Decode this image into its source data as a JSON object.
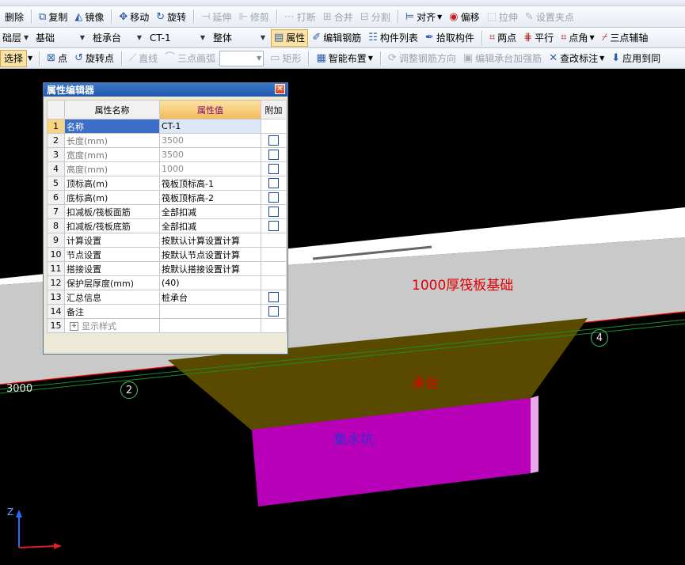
{
  "toolbar1": {
    "items": [
      {
        "label": "删除",
        "icon": "delete-icon"
      },
      {
        "label": "复制",
        "icon": "copy-icon"
      },
      {
        "label": "镜像",
        "icon": "mirror-icon"
      },
      {
        "label": "移动",
        "icon": "move-icon"
      },
      {
        "label": "旋转",
        "icon": "rotate-icon"
      },
      {
        "label": "延伸",
        "icon": "extend-icon",
        "disabled": true
      },
      {
        "label": "修剪",
        "icon": "trim-icon",
        "disabled": true
      },
      {
        "label": "打断",
        "icon": "break-icon",
        "disabled": true
      },
      {
        "label": "合并",
        "icon": "merge-icon",
        "disabled": true
      },
      {
        "label": "分割",
        "icon": "split-icon",
        "disabled": true
      },
      {
        "label": "对齐",
        "icon": "align-icon"
      },
      {
        "label": "偏移",
        "icon": "offset-icon"
      },
      {
        "label": "拉伸",
        "icon": "stretch-icon",
        "disabled": true
      },
      {
        "label": "设置夹点",
        "icon": "grip-icon",
        "disabled": true
      }
    ]
  },
  "toolbar2": {
    "floor": "础层",
    "category": "基础",
    "type": "桩承台",
    "element": "CT-1",
    "scope": "整体",
    "items": [
      {
        "label": "属性",
        "icon": "property-icon",
        "active": true
      },
      {
        "label": "编辑钢筋",
        "icon": "edit-rebar-icon"
      },
      {
        "label": "构件列表",
        "icon": "component-list-icon"
      },
      {
        "label": "拾取构件",
        "icon": "pick-icon"
      },
      {
        "label": "两点",
        "icon": "two-point-icon"
      },
      {
        "label": "平行",
        "icon": "parallel-icon"
      },
      {
        "label": "点角",
        "icon": "point-angle-icon"
      },
      {
        "label": "三点辅轴",
        "icon": "three-point-axis-icon"
      }
    ]
  },
  "toolbar3": {
    "select_label": "选择",
    "items": [
      {
        "label": "点",
        "icon": "point-icon"
      },
      {
        "label": "旋转点",
        "icon": "rotate-point-icon"
      },
      {
        "label": "直线",
        "icon": "line-icon",
        "disabled": true
      },
      {
        "label": "三点画弧",
        "icon": "arc-icon",
        "disabled": true
      }
    ],
    "items2": [
      {
        "label": "矩形",
        "icon": "rectangle-icon",
        "disabled": true
      },
      {
        "label": "智能布置",
        "icon": "smart-layout-icon",
        "dropdown": true
      },
      {
        "label": "调整钢筋方向",
        "icon": "adjust-rebar-direction-icon",
        "disabled": true
      },
      {
        "label": "编辑承台加强筋",
        "icon": "edit-reinforcement-icon",
        "disabled": true
      },
      {
        "label": "查改标注",
        "icon": "annotation-icon",
        "dropdown": true
      },
      {
        "label": "应用到同",
        "icon": "apply-icon"
      }
    ]
  },
  "property_editor": {
    "title": "属性编辑器",
    "headers": {
      "num": "",
      "name": "属性名称",
      "value": "属性值",
      "extra": "附加"
    },
    "rows": [
      {
        "num": "1",
        "name": "名称",
        "value": "CT-1",
        "checkbox": false,
        "selected": true
      },
      {
        "num": "2",
        "name": "长度(mm)",
        "value": "3500",
        "checkbox": true,
        "gray": true
      },
      {
        "num": "3",
        "name": "宽度(mm)",
        "value": "3500",
        "checkbox": true,
        "gray": true
      },
      {
        "num": "4",
        "name": "高度(mm)",
        "value": "1000",
        "checkbox": true,
        "gray": true
      },
      {
        "num": "5",
        "name": "顶标高(m)",
        "value": "筏板顶标高-1",
        "checkbox": true
      },
      {
        "num": "6",
        "name": "底标高(m)",
        "value": "筏板顶标高-2",
        "checkbox": true
      },
      {
        "num": "7",
        "name": "扣减板/筏板面筋",
        "value": "全部扣减",
        "checkbox": true
      },
      {
        "num": "8",
        "name": "扣减板/筏板底筋",
        "value": "全部扣减",
        "checkbox": true
      },
      {
        "num": "9",
        "name": "计算设置",
        "value": "按默认计算设置计算",
        "checkbox": false
      },
      {
        "num": "10",
        "name": "节点设置",
        "value": "按默认节点设置计算",
        "checkbox": false
      },
      {
        "num": "11",
        "name": "搭接设置",
        "value": "按默认搭接设置计算",
        "checkbox": false
      },
      {
        "num": "12",
        "name": "保护层厚度(mm)",
        "value": "(40)",
        "checkbox": false
      },
      {
        "num": "13",
        "name": "汇总信息",
        "value": "桩承台",
        "checkbox": true
      },
      {
        "num": "14",
        "name": "备注",
        "value": "",
        "checkbox": true
      },
      {
        "num": "15",
        "name": "显示样式",
        "value": "",
        "checkbox": false,
        "expandable": true,
        "gray": true
      }
    ]
  },
  "scene": {
    "raft_label": "1000厚筏板基础",
    "cap_label": "承台",
    "pit_label": "集水坑",
    "axis_left": "3000",
    "grid_a": "2",
    "grid_b": "4",
    "axis_z": "Z",
    "colors": {
      "raft": "#d9d9d9",
      "cap": "#5a4a00",
      "pit": "#b800b8",
      "label_red": "#e00000",
      "label_blue": "#3030d0",
      "grid_line": "#1e8a2a"
    }
  }
}
